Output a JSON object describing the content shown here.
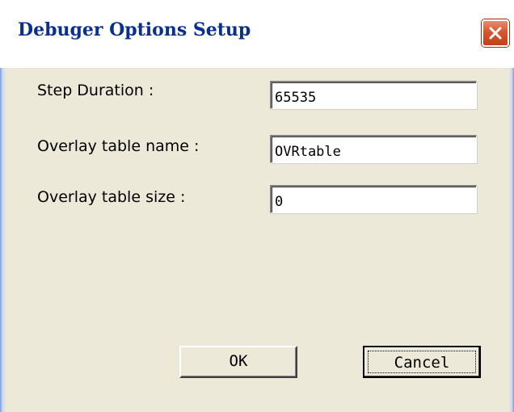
{
  "window": {
    "title": "Debuger Options Setup"
  },
  "fields": [
    {
      "label": "Step Duration :",
      "value": "65535"
    },
    {
      "label": "Overlay table name :",
      "value": "OVRtable"
    },
    {
      "label": "Overlay table size :",
      "value": "0"
    }
  ],
  "buttons": {
    "ok_label": "OK",
    "cancel_label": "Cancel"
  },
  "icons": {
    "close": "close-icon"
  },
  "colors": {
    "title_text": "#0b2f8c",
    "dialog_bg": "#ece9d8",
    "close_button": "#d7552f"
  }
}
